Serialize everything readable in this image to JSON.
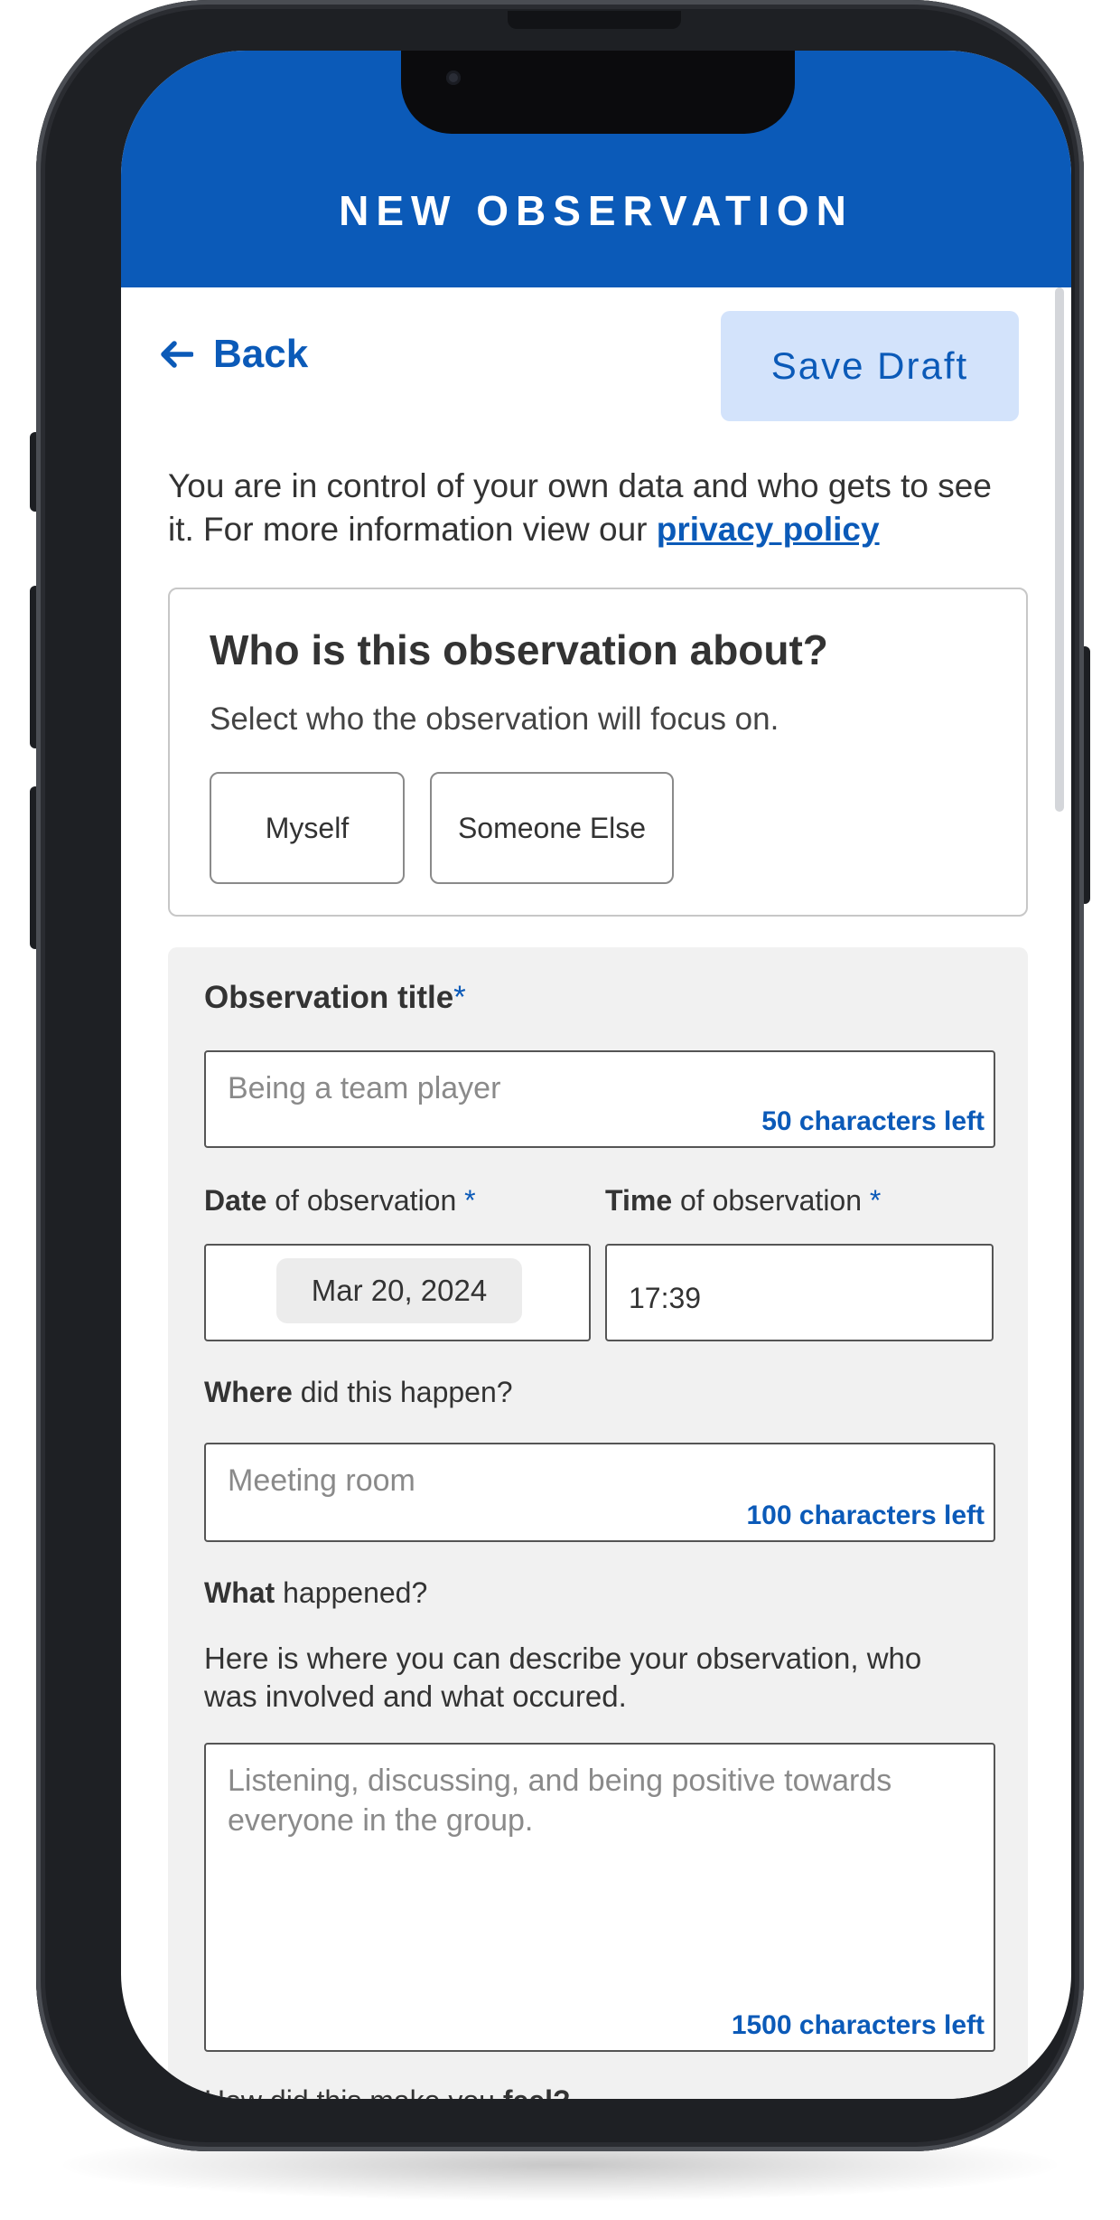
{
  "header": {
    "title": "NEW OBSERVATION"
  },
  "nav": {
    "back_label": "Back",
    "save_draft_label": "Save Draft"
  },
  "privacy": {
    "text": "You are in control of your own data and who gets to see it. For more information view our ",
    "link_label": "privacy policy"
  },
  "who": {
    "title": "Who is this observation about?",
    "subtitle": "Select who the observation will focus on.",
    "options": [
      "Myself",
      "Someone Else"
    ]
  },
  "form": {
    "title": {
      "label": "Observation title",
      "required_mark": "*",
      "placeholder": "Being a team player",
      "counter": "50 characters left"
    },
    "date": {
      "label_bold": "Date",
      "label_rest": " of observation ",
      "required_mark": "*",
      "value": "Mar 20, 2024"
    },
    "time": {
      "label_bold": "Time",
      "label_rest": " of observation ",
      "required_mark": "*",
      "value": "17:39"
    },
    "where": {
      "label_bold": "Where",
      "label_rest": " did this happen?",
      "placeholder": "Meeting room",
      "counter": "100 characters left"
    },
    "what": {
      "label_bold": "What",
      "label_rest": " happened?",
      "help": "Here is where you can describe your observation, who was involved and what occured.",
      "placeholder": "Listening, discussing, and being positive towards everyone in the group.",
      "counter": "1500 characters left"
    },
    "feel": {
      "label_rest": "How did this make you ",
      "label_bold": "feel?"
    }
  },
  "colors": {
    "brand_blue": "#0b5ab8",
    "save_draft_bg": "#d3e3fb",
    "form_card_bg": "#f1f1f1",
    "phone_frame": "#1e2024"
  },
  "icons": {
    "back": "arrow-left-icon"
  }
}
